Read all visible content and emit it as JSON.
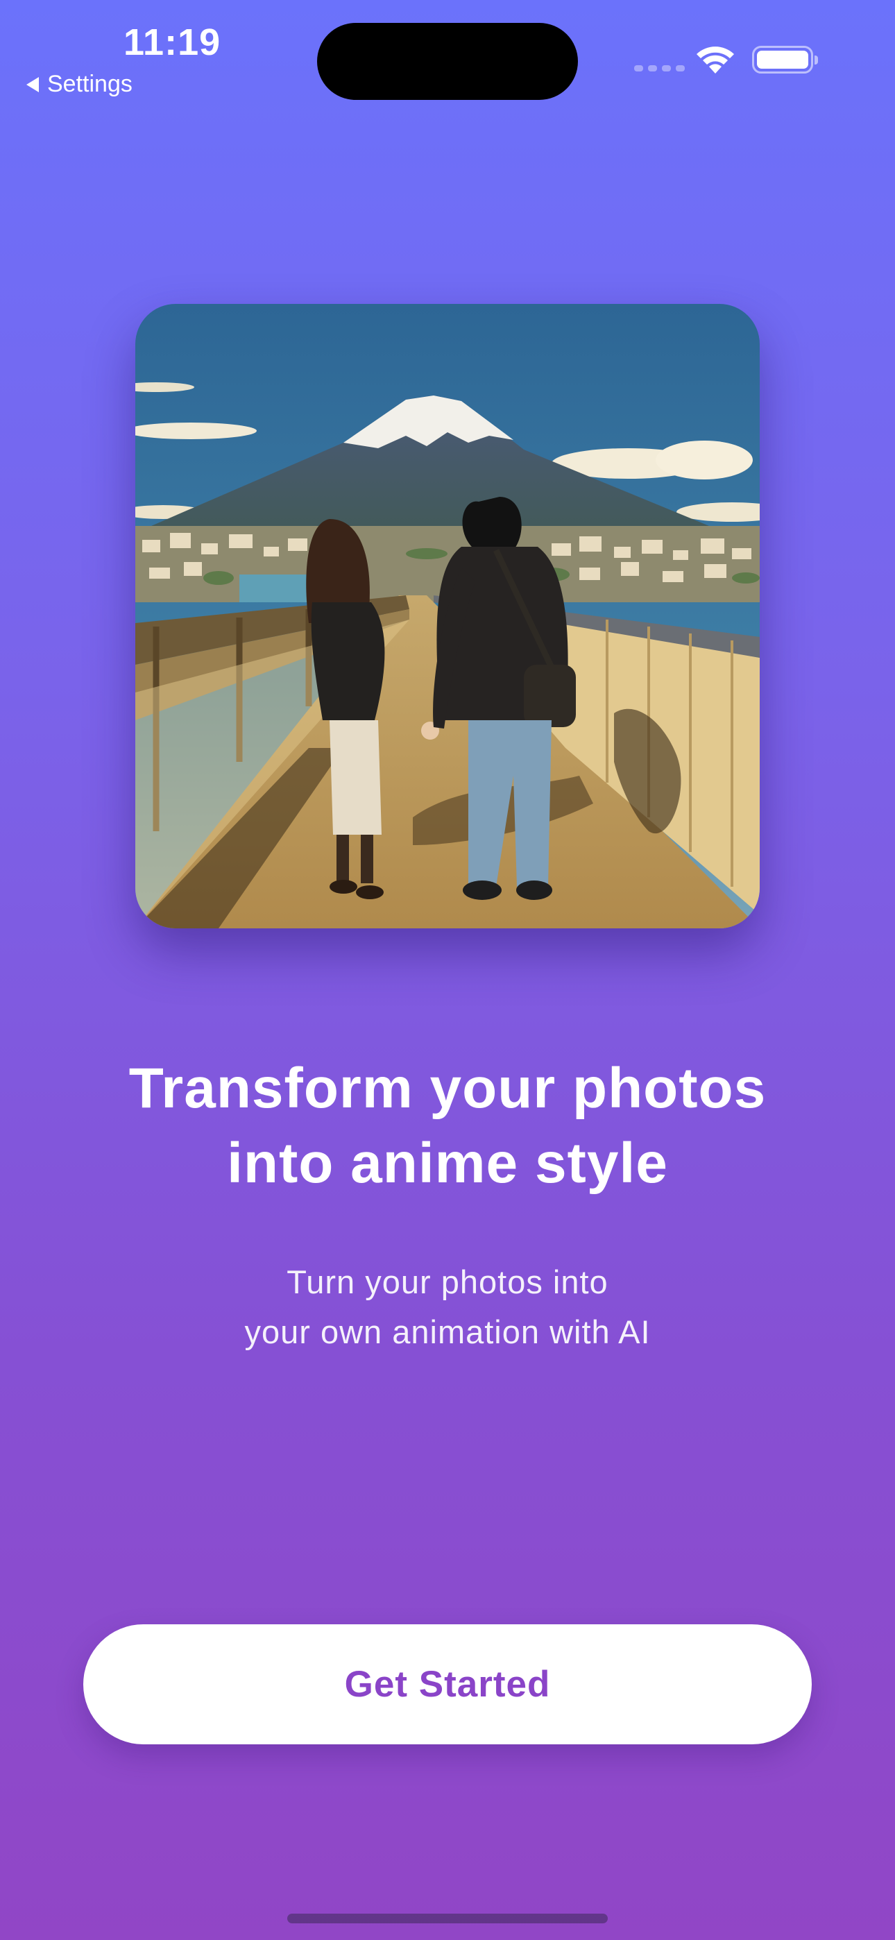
{
  "status_bar": {
    "time": "11:19",
    "back_label": "Settings"
  },
  "hero": {
    "illustration": "anime-couple-holding-hands-on-bridge-with-mountain"
  },
  "content": {
    "headline": "Transform your photos\ninto anime style",
    "subtitle": "Turn your photos into\nyour own animation with AI"
  },
  "actions": {
    "primary_label": "Get Started"
  },
  "colors": {
    "gradient_top": "#6b72fb",
    "gradient_bottom": "#9146c6",
    "button_text": "#8a44c8",
    "button_background": "#ffffff"
  },
  "icons": [
    "back-caret-icon",
    "cellular-icon",
    "wifi-icon",
    "battery-icon"
  ]
}
